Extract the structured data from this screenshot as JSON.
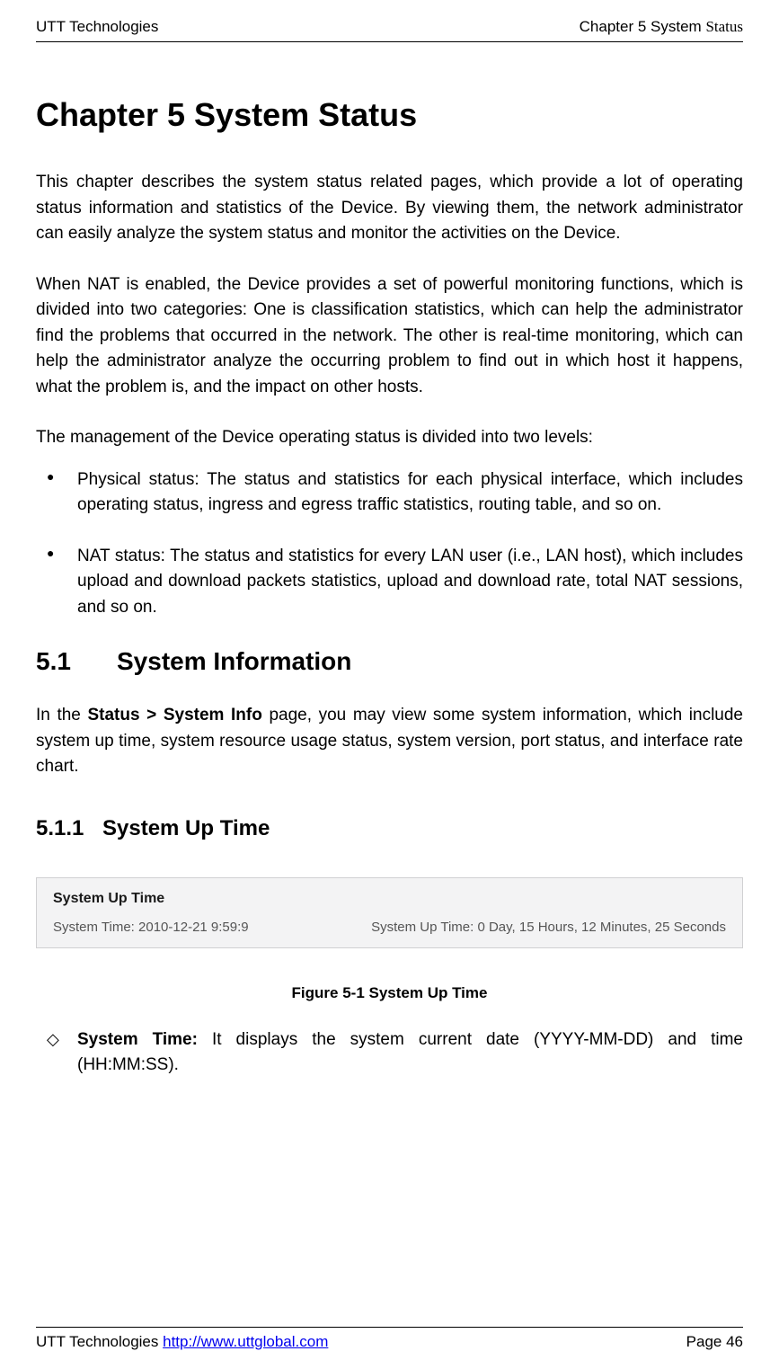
{
  "header": {
    "left": "UTT Technologies",
    "right_prefix": "Chapter 5 System ",
    "right_status": "Status"
  },
  "chapter": {
    "title": "Chapter 5 System Status"
  },
  "para1": "This chapter describes the system status related pages, which provide a lot of operating status information and statistics of the Device. By viewing them, the network administrator can easily analyze the system status and monitor the activities on the Device.",
  "para2": "When NAT is enabled, the Device provides a set of powerful monitoring functions, which is divided into two categories: One is classification statistics, which can help the administrator find the problems that occurred in the network. The other is real-time monitoring, which can help the administrator analyze the occurring problem to find out in which host it happens, what the problem is, and the impact on other hosts.",
  "para3": "The management of the Device operating status is divided into two levels:",
  "bullets": [
    "Physical status: The status and statistics for each physical interface, which includes operating status, ingress and egress traffic statistics, routing table, and so on.",
    "NAT status: The status and statistics for every LAN user (i.e., LAN host), which includes upload and download packets statistics, upload and download rate, total NAT sessions, and so on."
  ],
  "section51": {
    "num": "5.1",
    "title": "System Information",
    "intro_prefix": "In the ",
    "intro_bold": "Status > System Info",
    "intro_suffix": " page, you may view some system information, which include system up time, system resource usage status, system version, port status, and interface rate chart."
  },
  "section511": {
    "num": "5.1.1",
    "title": "System Up Time"
  },
  "screenshot": {
    "title": "System Up Time",
    "left_label": "System Time: ",
    "left_value": "2010-12-21 9:59:9",
    "right_label": "System Up Time: ",
    "right_value": "0 Day, 15 Hours, 12 Minutes, 25 Seconds"
  },
  "figure_caption": "Figure 5-1 System Up Time",
  "diamond": {
    "term": "System Time:",
    "desc": " It displays the system current date (YYYY-MM-DD) and time (HH:MM:SS)."
  },
  "footer": {
    "left_text": "UTT Technologies ",
    "link_text": "http://www.uttglobal.com",
    "page": "Page 46"
  }
}
